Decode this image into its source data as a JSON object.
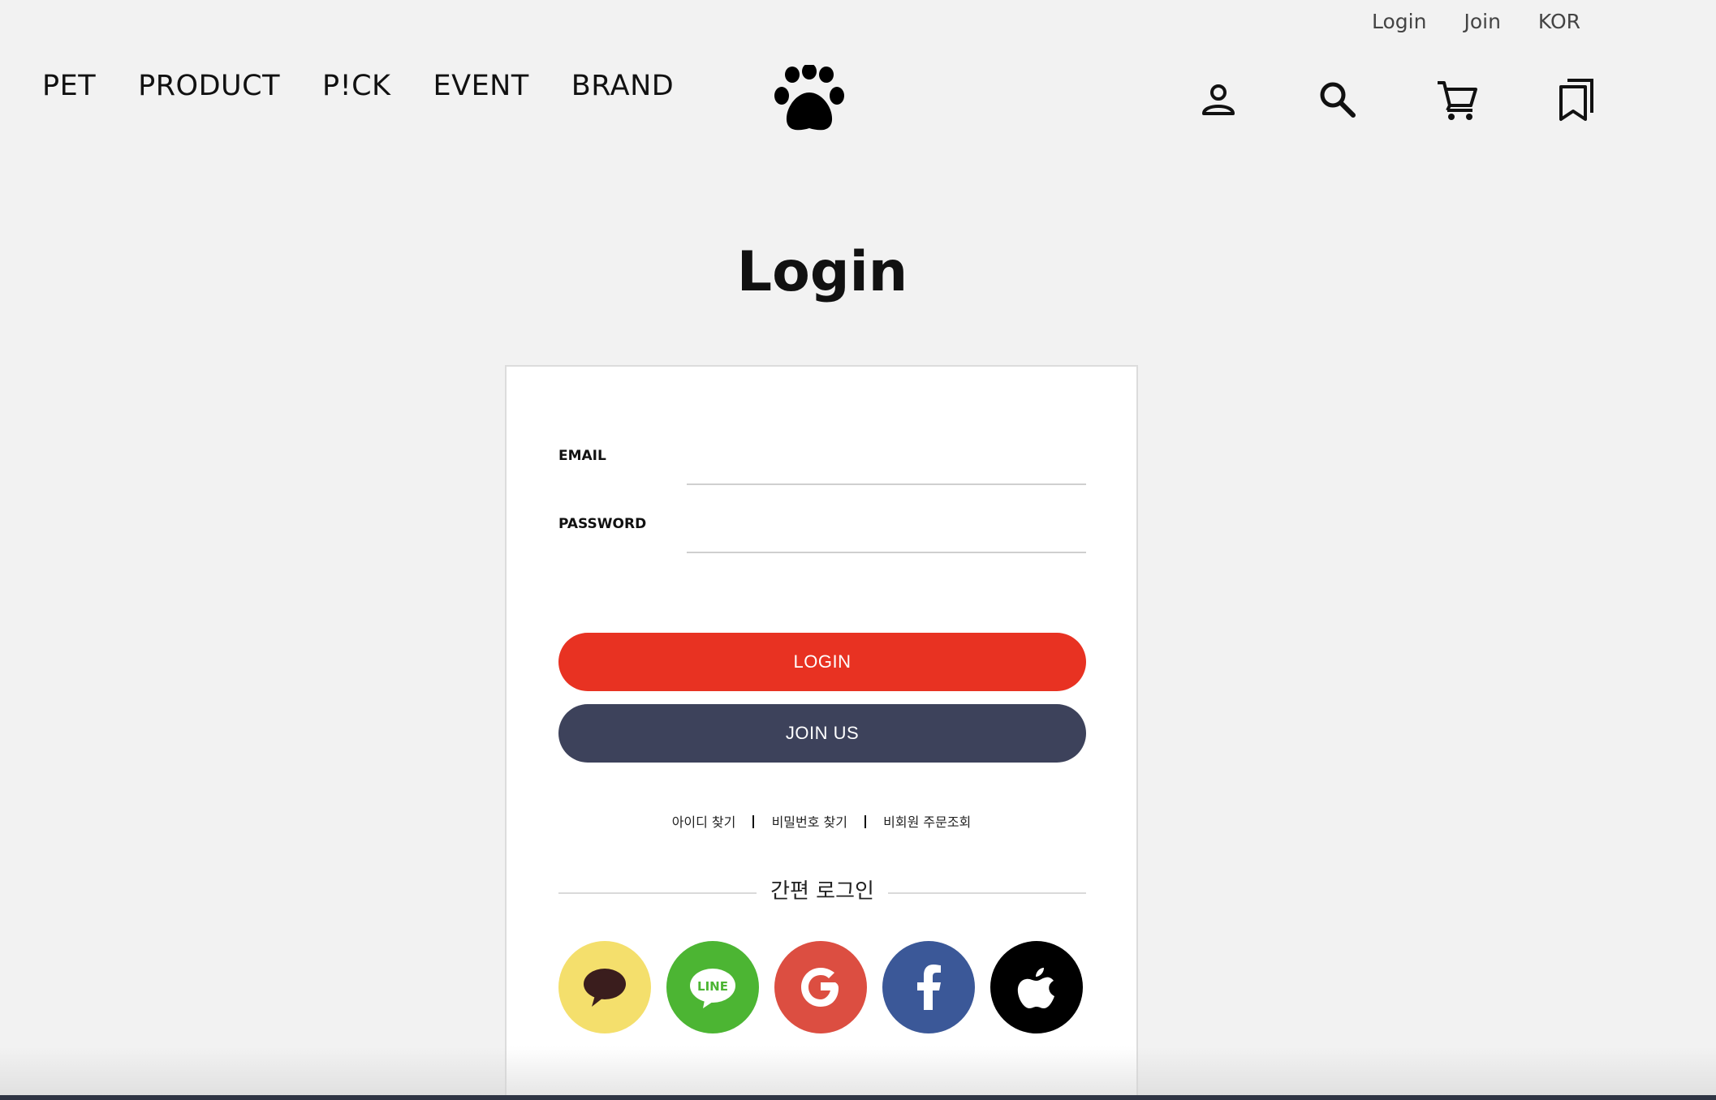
{
  "util": {
    "login": "Login",
    "join": "Join",
    "lang": "KOR"
  },
  "nav": [
    "PET",
    "PRODUCT",
    "P!CK",
    "EVENT",
    "BRAND"
  ],
  "logo": "paw-icon",
  "header_icons": [
    "user-icon",
    "search-icon",
    "cart-icon",
    "bookmark-icon"
  ],
  "page": {
    "title": "Login"
  },
  "form": {
    "email_label": "EMAIL",
    "email_value": "",
    "password_label": "PASSWORD",
    "password_value": "",
    "login_button": "LOGIN",
    "join_button": "JOIN US"
  },
  "links": [
    "아이디 찾기",
    "비밀번호 찾기",
    "비회원 주문조회"
  ],
  "easy_login": {
    "title": "간편 로그인",
    "providers": [
      {
        "name": "kakao",
        "color": "#f4df6c"
      },
      {
        "name": "LINE",
        "color": "#4cb533"
      },
      {
        "name": "google",
        "color": "#dc4e41"
      },
      {
        "name": "facebook",
        "color": "#3b5898"
      },
      {
        "name": "apple",
        "color": "#000000"
      }
    ]
  },
  "colors": {
    "login": "#e83222",
    "join": "#3d425b",
    "background": "#f2f2f2"
  }
}
